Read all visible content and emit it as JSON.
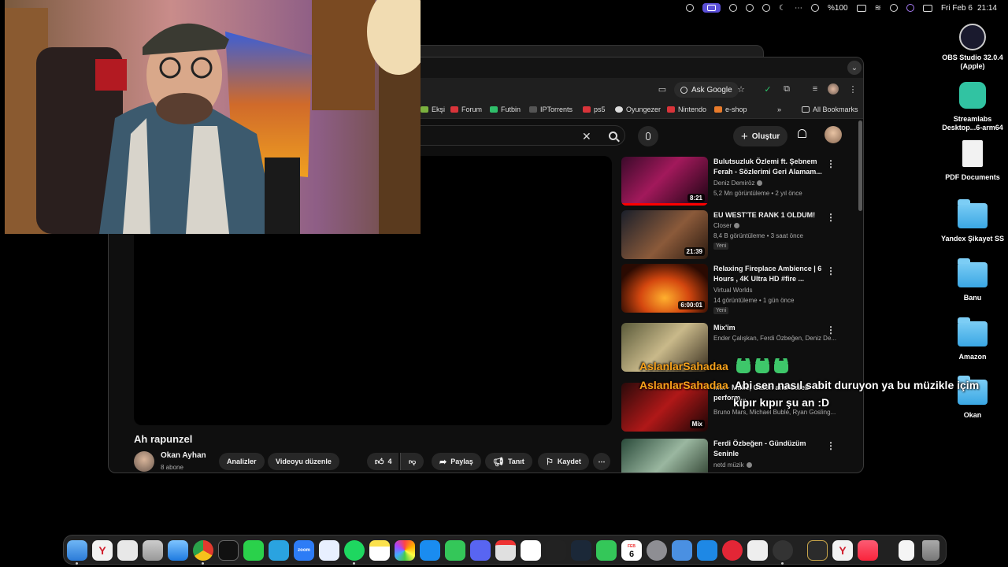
{
  "menubar": {
    "battery": "%100",
    "date": "Fri Feb 6",
    "time": "21:14"
  },
  "desktop": {
    "items": [
      {
        "label": "OBS Studio 32.0.4 (Apple)",
        "icon": "obs-icon"
      },
      {
        "label": "Streamlabs Desktop...6-arm64",
        "icon": "streamlabs-icon"
      },
      {
        "label": "PDF Documents",
        "icon": "document-icon"
      },
      {
        "label": "Yandex Şikayet SS",
        "icon": "folder-icon"
      },
      {
        "label": "Banu",
        "icon": "folder-icon"
      },
      {
        "label": "Amazon",
        "icon": "folder-icon"
      },
      {
        "label": "Okan",
        "icon": "folder-icon"
      }
    ]
  },
  "browser": {
    "ask_google": "Ask Google",
    "bookmarks": [
      "Ekşi",
      "Forum",
      "Futbin",
      "IPTorrents",
      "ps5",
      "Oyungezer",
      "Nintendo",
      "e-shop"
    ],
    "more_bookmarks": "»",
    "all_bookmarks": "All Bookmarks"
  },
  "youtube": {
    "create_label": "Oluştur",
    "video": {
      "title": "Ah rapunzel",
      "channel": "Okan Ayhan",
      "subscribers": "8 abone",
      "analytics_label": "Analizler",
      "edit_label": "Videoyu düzenle",
      "likes": "4",
      "share_label": "Paylaş",
      "promote_label": "Tanıt",
      "save_label": "Kaydet"
    },
    "recommendations": [
      {
        "title": "Bulutsuzluk Özlemi ft. Şebnem Ferah - Sözlerimi Geri Alamam...",
        "channel": "Deniz Demiröz",
        "meta": "5,2 Mn görüntüleme • 2 yıl önce",
        "duration": "8:21",
        "new": "",
        "verified": true
      },
      {
        "title": "EU WEST'TE RANK 1 OLDUM!",
        "channel": "Closer",
        "meta": "8,4 B görüntüleme • 3 saat önce",
        "duration": "21:39",
        "new": "Yeni",
        "verified": true
      },
      {
        "title": "Relaxing Fireplace Ambience | 6 Hours , 4K Ultra HD #fire ...",
        "channel": "Virtual Worlds",
        "meta": "14 görüntüleme • 1 gün önce",
        "duration": "6:00:01",
        "new": "Yeni",
        "verified": false
      },
      {
        "title": "Mix'im",
        "channel": "Ender Çalışkan, Ferdi Özbeğen, Deniz De...",
        "meta": "",
        "duration": "",
        "new": "",
        "verified": false
      },
      {
        "title": "Mix - Millie, Gaten and Caleb perform...",
        "channel": "Bruno Mars, Michael Bublé, Ryan Gosling...",
        "meta": "",
        "duration": "Mix",
        "new": "",
        "verified": false
      },
      {
        "title": "Ferdi Özbeğen - Gündüzüm Seninle",
        "channel": "netd müzik",
        "meta": "",
        "duration": "",
        "new": "",
        "verified": true
      }
    ]
  },
  "chat": [
    {
      "user": "AslanlarSahadaa",
      "message": ""
    },
    {
      "user": "AslanlarSahadaa",
      "message": "Abi sen nasıl sabit duruyon ya bu müzikle içim"
    },
    {
      "user": "",
      "message": "kıpır kıpır şu an :D"
    }
  ],
  "dock": {
    "calendar_month": "FEB",
    "calendar_day": "6"
  }
}
